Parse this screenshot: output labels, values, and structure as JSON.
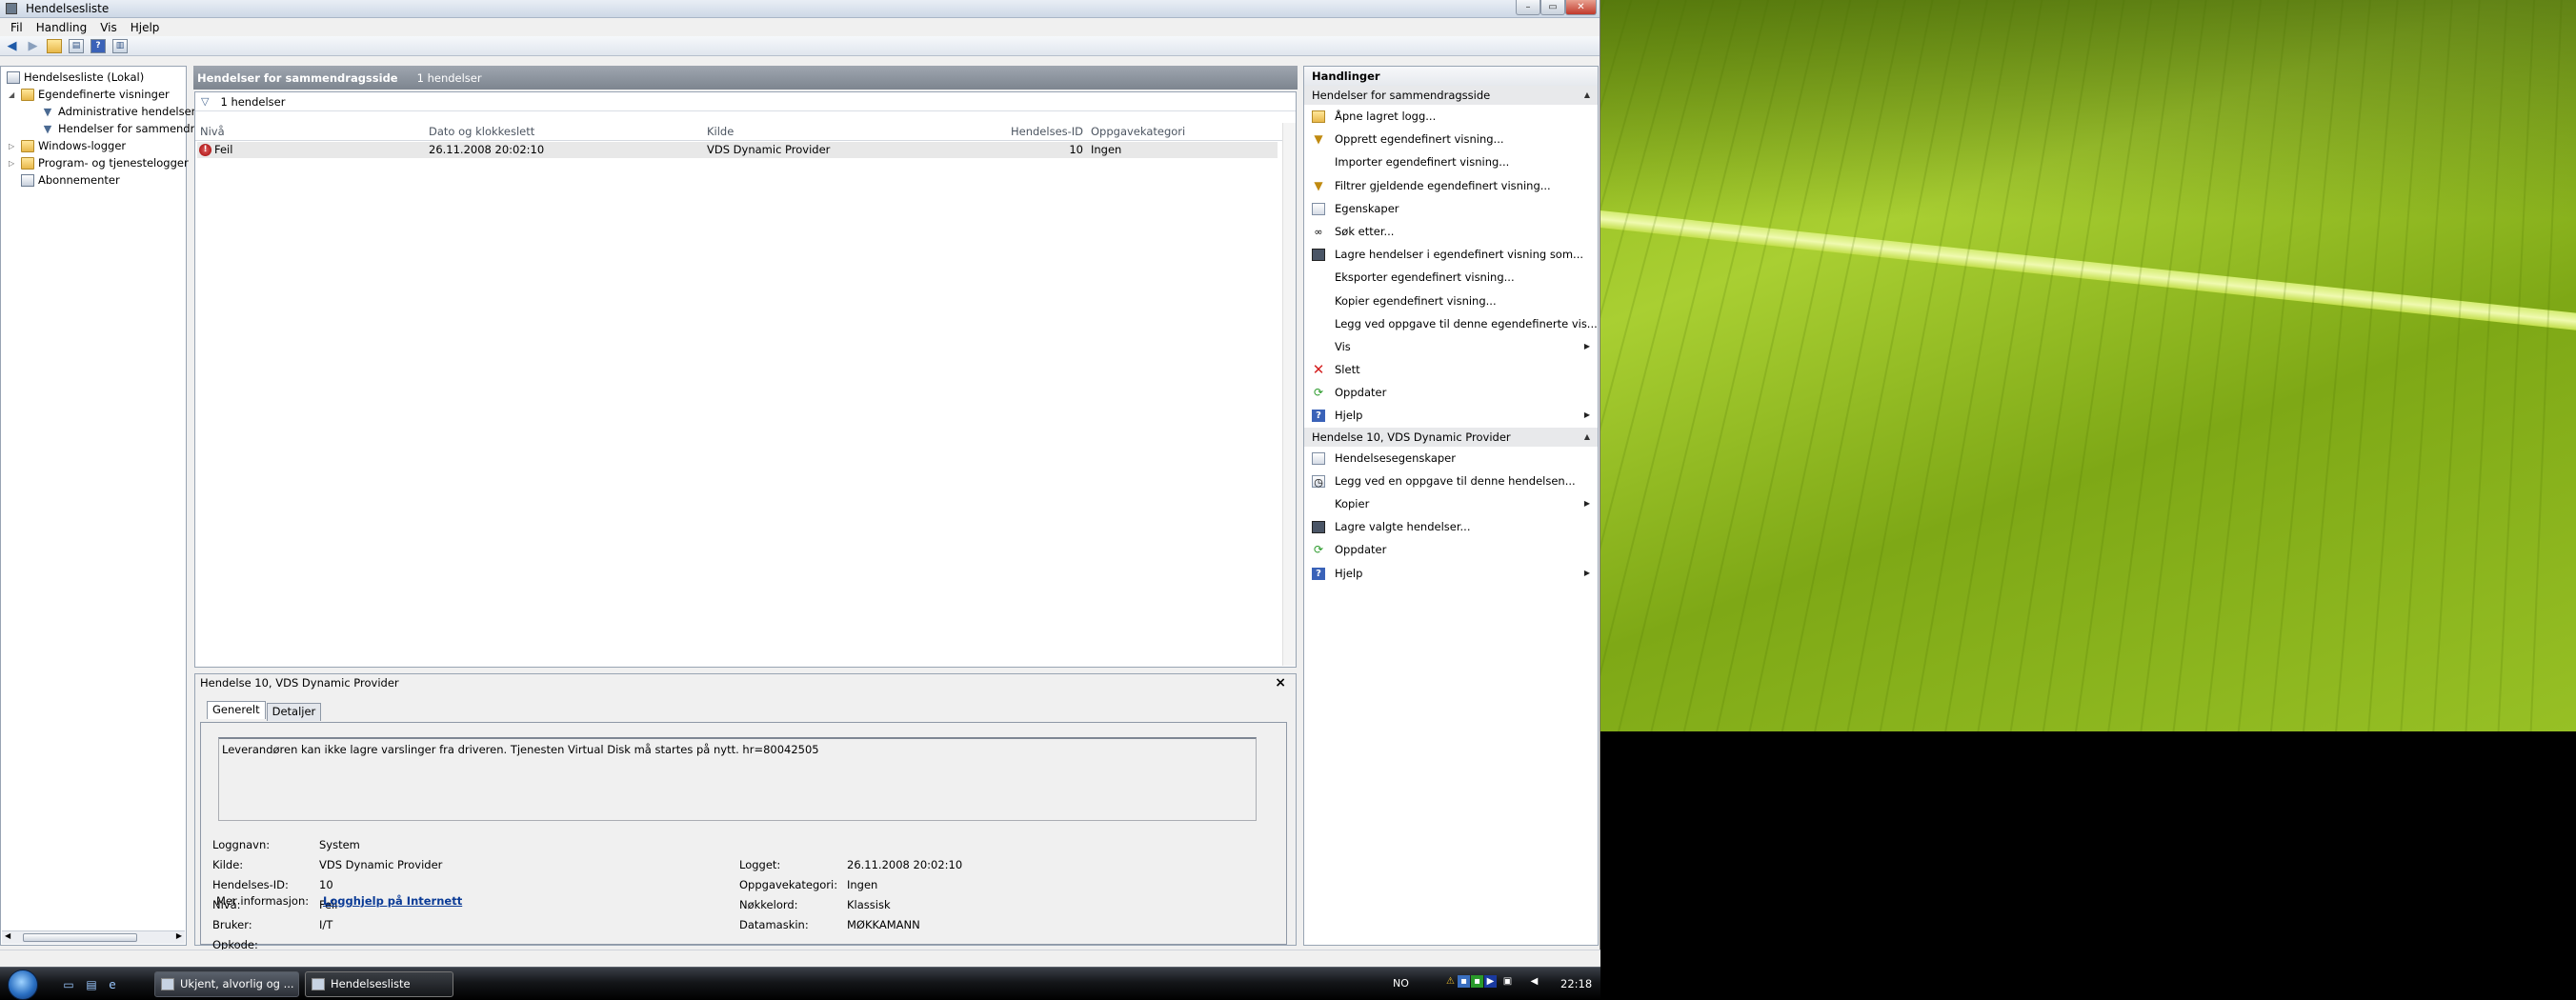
{
  "window": {
    "title": "Hendelsesliste"
  },
  "menu": [
    "Fil",
    "Handling",
    "Vis",
    "Hjelp"
  ],
  "tree": {
    "root": "Hendelsesliste (Lokal)",
    "custom_views": "Egendefinerte visninger",
    "admin_events": "Administrative hendelser",
    "summary_events": "Hendelser for sammendr",
    "windows_logs": "Windows-logger",
    "app_logs": "Program- og tjenestelogger",
    "subscriptions": "Abonnementer"
  },
  "center": {
    "header_title": "Hendelser for sammendragsside",
    "header_count": "1 hendelser",
    "filter_count": "1 hendelser",
    "columns": [
      "Nivå",
      "Dato og klokkeslett",
      "Kilde",
      "Hendelses-ID",
      "Oppgavekategori"
    ],
    "rows": [
      {
        "level": "Feil",
        "datetime": "26.11.2008 20:02:10",
        "source": "VDS Dynamic Provider",
        "id": "10",
        "category": "Ingen"
      }
    ]
  },
  "details": {
    "title": "Hendelse 10, VDS Dynamic Provider",
    "close": "×",
    "tabs": [
      "Generelt",
      "Detaljer"
    ],
    "message": "Leverandøren kan ikke lagre varslinger fra driveren. Tjenesten Virtual Disk må startes på nytt. hr=80042505",
    "labels": {
      "log_name": "Loggnavn:",
      "source": "Kilde:",
      "event_id": "Hendelses-ID:",
      "level": "Nivå:",
      "user": "Bruker:",
      "opcode": "Opkode:",
      "more_info": "Mer informasjon:",
      "logged": "Logget:",
      "task_category": "Oppgavekategori:",
      "keywords": "Nøkkelord:",
      "computer": "Datamaskin:"
    },
    "values": {
      "log_name": "System",
      "source": "VDS Dynamic Provider",
      "event_id": "10",
      "level": "Feil",
      "user": "I/T",
      "opcode": "",
      "more_info": "Logghjelp på Internett",
      "logged": "26.11.2008 20:02:10",
      "task_category": "Ingen",
      "keywords": "Klassisk",
      "computer": "MØKKAMANN"
    }
  },
  "actions": {
    "title": "Handlinger",
    "section1": "Hendelser for sammendragsside",
    "items1": [
      {
        "label": "Åpne lagret logg...",
        "icon": "folder-icon"
      },
      {
        "label": "Opprett egendefinert visning...",
        "icon": "funnel-icon"
      },
      {
        "label": "Importer egendefinert visning...",
        "icon": ""
      },
      {
        "label": "Filtrer gjeldende egendefinert visning...",
        "icon": "filter-icon"
      },
      {
        "label": "Egenskaper",
        "icon": "properties-icon"
      },
      {
        "label": "Søk etter...",
        "icon": "binoculars-icon"
      },
      {
        "label": "Lagre hendelser i egendefinert visning som...",
        "icon": "save-icon"
      },
      {
        "label": "Eksporter egendefinert visning...",
        "icon": ""
      },
      {
        "label": "Kopier egendefinert visning...",
        "icon": ""
      },
      {
        "label": "Legg ved oppgave til denne egendefinerte vis...",
        "icon": ""
      },
      {
        "label": "Vis",
        "icon": "",
        "submenu": true
      },
      {
        "label": "Slett",
        "icon": "delete-icon"
      },
      {
        "label": "Oppdater",
        "icon": "refresh-icon"
      },
      {
        "label": "Hjelp",
        "icon": "help-icon",
        "submenu": true
      }
    ],
    "section2": "Hendelse 10, VDS Dynamic Provider",
    "items2": [
      {
        "label": "Hendelsesegenskaper",
        "icon": "properties-icon"
      },
      {
        "label": "Legg ved en oppgave til denne hendelsen...",
        "icon": "task-icon"
      },
      {
        "label": "Kopier",
        "icon": "",
        "submenu": true
      },
      {
        "label": "Lagre valgte hendelser...",
        "icon": "save-icon"
      },
      {
        "label": "Oppdater",
        "icon": "refresh-icon"
      },
      {
        "label": "Hjelp",
        "icon": "help-icon",
        "submenu": true
      }
    ]
  },
  "taskbar": {
    "tasks": [
      {
        "label": "Ukjent, alvorlig og ..."
      },
      {
        "label": "Hendelsesliste"
      }
    ],
    "language": "NO",
    "clock": "22:18"
  }
}
